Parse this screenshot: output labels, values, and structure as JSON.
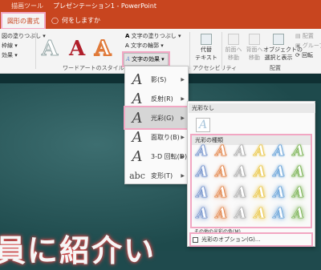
{
  "titlebar": {
    "tool_label": "描画ツール",
    "title": "プレゼンテーション1 - PowerPoint"
  },
  "tabs": {
    "active": "図形の書式",
    "tell_me": "何をしますか"
  },
  "ribbon": {
    "left_items": [
      "図の塗りつぶし",
      "枠線",
      "効果"
    ],
    "wordart_group": "ワードアートのスタイル",
    "text_fill": "文字の塗りつぶし",
    "text_outline": "文字の輪郭",
    "text_effect": "文字の効果",
    "alt_text": "代替\nテキスト",
    "accessibility": "アクセシビリティ",
    "front": "前面へ\n移動",
    "back": "背面へ\n移動",
    "selection_pane": "オブジェクトの\n選択と表示",
    "arrange_group": "配置",
    "align": "配置",
    "group": "グループ化",
    "rotate": "回転"
  },
  "effect_menu": [
    {
      "label": "影(S)",
      "icon": "A"
    },
    {
      "label": "反射(R)",
      "icon": "A"
    },
    {
      "label": "光彩(G)",
      "icon": "A"
    },
    {
      "label": "面取り(B)",
      "icon": "A"
    },
    {
      "label": "3-D 回転(D)",
      "icon": "A"
    },
    {
      "label": "変形(T)",
      "icon": "abc"
    }
  ],
  "glow_submenu": {
    "no_glow_header": "光彩なし",
    "variations_header": "光彩の種類",
    "more_colors": "その他の光彩の色(M)",
    "options": "光彩のオプション(G)..."
  },
  "glow_colors": [
    "#6b8cc9",
    "#e07a3a",
    "#a8a8a8",
    "#e8c23a",
    "#5b9bd5",
    "#70ad47"
  ],
  "slide_text": "員に紹介い"
}
